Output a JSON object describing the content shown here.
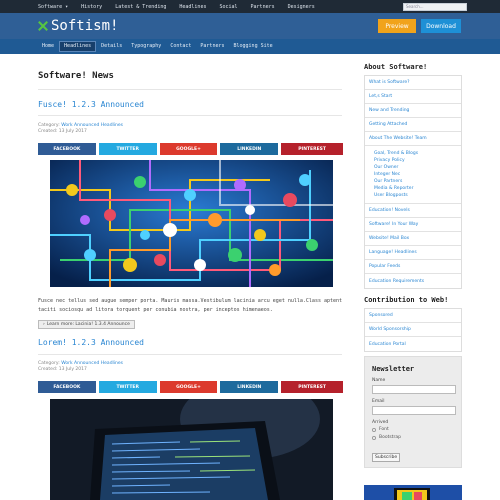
{
  "topbar": {
    "items": [
      "Software ▾",
      "History",
      "Latest & Trending",
      "Headlines",
      "Social",
      "Partners",
      "Designers"
    ],
    "search_placeholder": "Search..."
  },
  "header": {
    "logo_text": "Softism!",
    "preview_label": "Preview",
    "download_label": "Download"
  },
  "subnav": {
    "items": [
      "Home",
      "Headlines",
      "Details",
      "Typography",
      "Contact",
      "Partners",
      "Blogging Site"
    ],
    "active_index": 1
  },
  "main": {
    "page_title": "Software! News",
    "posts": [
      {
        "title": "Fusce! 1.2.3 Announced",
        "category_label": "Category:",
        "category": "Work Announced Headlines",
        "created": "Created: 13 July 2017",
        "excerpt": "Fusce nec tellus sed augue semper porta. Mauris massa.Vestibulum lacinia arcu eget nulla.Class aptent taciti sociosqu ad litora torquent per conubia nostra, per inceptos himenaeos.",
        "learn_more": "Learn more: Lacinia! 1.3.4 Announce"
      },
      {
        "title": "Lorem! 1.2.3 Announced",
        "category_label": "Category:",
        "category": "Work Announced Headlines",
        "created": "Created: 13 July 2017"
      }
    ],
    "share": {
      "facebook": "FACEBOOK",
      "twitter": "TWITTER",
      "googleplus": "GOOGLE+",
      "linkedin": "LINKEDIN",
      "pinterest": "PINTEREST"
    }
  },
  "sidebar": {
    "about_title": "About Software!",
    "about_items": [
      "What is Software?",
      "Let,s Start",
      "New and Trending",
      "Getting Attached",
      "About The Website! Team"
    ],
    "about_subitems": [
      "Goal, Trend & Blogs",
      "Privacy Policy",
      "Our Owner",
      "Integer Nec",
      "Our Partners",
      "Media & Reporter",
      "User Blogposts"
    ],
    "about_items_after": [
      "Education! Novels",
      "Software! In Your Way",
      "Website! Mail Box",
      "Language! Headlines",
      "Popular Feeds",
      "Education Requirements"
    ],
    "contribution_title": "Contribution to Web!",
    "contribution_items": [
      "Sponsored",
      "World Sponsorship",
      "Education Portal"
    ],
    "newsletter": {
      "title": "Newsletter",
      "name_label": "Name",
      "email_label": "Email",
      "arrived_label": "Arrived",
      "radio_1": "Font",
      "radio_2": "Bootstrap",
      "subscribe": "Subscribe"
    }
  }
}
